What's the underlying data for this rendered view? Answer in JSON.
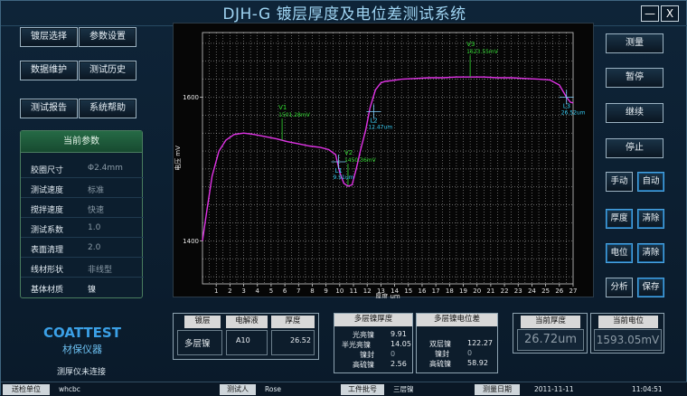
{
  "window": {
    "title": "DJH-G 镀层厚度及电位差测试系统",
    "minimize": "—",
    "close": "X"
  },
  "menu": {
    "coating_select": "镀层选择",
    "param_settings": "参数设置",
    "data_maintenance": "数据维护",
    "test_history": "测试历史",
    "test_report": "测试报告",
    "system_help": "系统帮助"
  },
  "params": {
    "title": "当前参数",
    "rows": [
      {
        "label": "胶圈尺寸",
        "value": "Φ2.4mm"
      },
      {
        "label": "测试速度",
        "value": "标准"
      },
      {
        "label": "搅拌速度",
        "value": "快速"
      },
      {
        "label": "测试系数",
        "value": "1.0"
      },
      {
        "label": "表面清理",
        "value": "2.0"
      },
      {
        "label": "线材形状",
        "value": "非线型"
      },
      {
        "label": "基体材质",
        "value": "镍"
      }
    ]
  },
  "logo": {
    "brand": "COATTEST",
    "sub": "材保仪器",
    "connection": "测厚仪未连接"
  },
  "controls": {
    "measure": "测量",
    "pause": "暂停",
    "continue": "继续",
    "stop": "停止",
    "manual": "手动",
    "auto": "自动",
    "thickness": "厚度",
    "clear1": "清除",
    "potential": "电位",
    "clear2": "清除",
    "analyze": "分析",
    "save": "保存"
  },
  "bottom": {
    "coating": {
      "header": "镀层",
      "value": "多层镍"
    },
    "electrolyte": {
      "header": "电解液",
      "value": "A10"
    },
    "thickness": {
      "header": "厚度",
      "value": "26.52"
    },
    "multi_thickness": {
      "header": "多层镍厚度",
      "rows": [
        {
          "label": "光亮镍",
          "value": "9.91"
        },
        {
          "label": "半光亮镍",
          "value": "14.05"
        },
        {
          "label": "镍封",
          "value": "0"
        },
        {
          "label": "高硫镍",
          "value": "2.56"
        }
      ]
    },
    "multi_potential": {
      "header": "多层镍电位差",
      "rows": [
        {
          "label": "双层镍",
          "value": "122.27"
        },
        {
          "label": "镍封",
          "value": "0"
        },
        {
          "label": "高硫镍",
          "value": "58.92"
        }
      ]
    },
    "current_thickness": {
      "header": "当前厚度",
      "value": "26.72um"
    },
    "current_potential": {
      "header": "当前电位",
      "value": "1593.05mV"
    }
  },
  "status": {
    "unit_label": "送检单位",
    "unit_value": "whcbc",
    "tester_label": "测试人",
    "tester_value": "Rose",
    "batch_label": "工件批号",
    "batch_value": "三层镍",
    "date_label": "测量日期",
    "date_value": "2011-11-11",
    "time_value": "11:04:51"
  },
  "colors": {
    "curve": "#e033e6",
    "grid": "#ffffff",
    "annotation_green": "#33dd33",
    "annotation_cyan": "#33c8f0",
    "cross": "#7fd0ff"
  },
  "chart_data": {
    "type": "line",
    "xlabel": "厚度 um",
    "ylabel": "电压 mV",
    "xlim": [
      0,
      27
    ],
    "ylim": [
      1340,
      1690
    ],
    "x_ticks": [
      1,
      2,
      3,
      4,
      5,
      6,
      7,
      8,
      9,
      10,
      11,
      12,
      13,
      14,
      15,
      16,
      17,
      18,
      19,
      20,
      21,
      22,
      23,
      24,
      25,
      26,
      27
    ],
    "y_ticks": [
      1400,
      1600
    ],
    "grid": true,
    "series": [
      {
        "x": [
          0,
          0.3,
          0.7,
          1.2,
          1.7,
          2.3,
          3.0,
          3.8,
          4.6,
          5.4,
          6.2,
          7.0,
          7.8,
          8.6,
          9.2,
          9.7,
          10.0,
          10.3,
          10.6,
          10.9,
          11.2,
          11.5,
          11.9,
          12.2,
          12.6,
          13.0,
          13.3,
          13.8,
          14.5,
          15.5,
          16.5,
          17.5,
          18.5,
          19.5,
          20.5,
          21.5,
          22.5,
          23.5,
          24.5,
          25.3,
          26.0,
          26.52,
          26.8,
          27.0
        ],
        "y": [
          1400,
          1440,
          1490,
          1525,
          1540,
          1548,
          1550,
          1548,
          1545,
          1542,
          1538,
          1535,
          1532,
          1530,
          1527,
          1520,
          1495,
          1480,
          1476,
          1478,
          1500,
          1525,
          1555,
          1585,
          1610,
          1620,
          1622,
          1623,
          1625,
          1626,
          1627,
          1627,
          1628,
          1628,
          1628,
          1627,
          1627,
          1626,
          1625,
          1624,
          1617,
          1600,
          1593,
          1592
        ]
      }
    ],
    "annotations": [
      {
        "name": "V1",
        "text": "1501.28mV",
        "x": 5.8,
        "y": 1540,
        "color": "green"
      },
      {
        "name": "V2",
        "text": "1450.36mV",
        "x": 10.6,
        "y": 1477,
        "color": "green"
      },
      {
        "name": "V3",
        "text": "1623.55mV",
        "x": 19.5,
        "y": 1628,
        "color": "green"
      },
      {
        "name": "L1",
        "text": "9.91um",
        "x": 9.91,
        "y": 1510,
        "color": "cyan"
      },
      {
        "name": "L2",
        "text": "12.47um",
        "x": 12.47,
        "y": 1580,
        "color": "cyan"
      },
      {
        "name": "L3",
        "text": "26.52um",
        "x": 26.52,
        "y": 1600,
        "color": "cyan"
      }
    ]
  }
}
